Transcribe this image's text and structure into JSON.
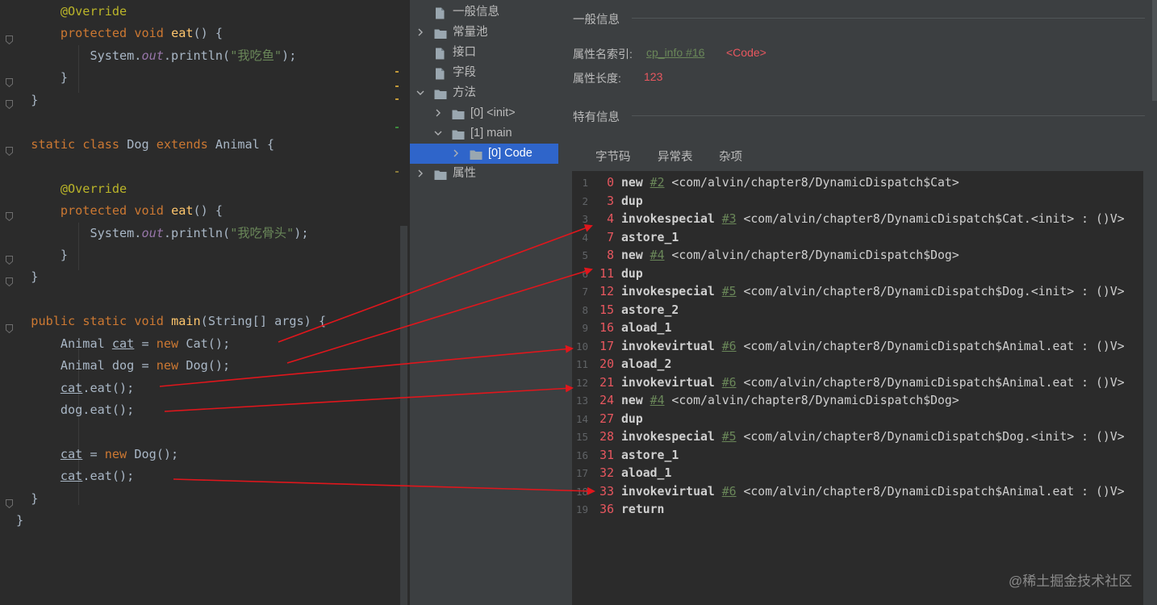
{
  "editor": {
    "lines": [
      {
        "id": "l1",
        "indent": "      ",
        "tokens": [
          {
            "t": "@Override",
            "c": "ann"
          }
        ]
      },
      {
        "id": "l2",
        "indent": "      ",
        "tokens": [
          {
            "t": "protected",
            "c": "kw"
          },
          {
            "t": " "
          },
          {
            "t": "void",
            "c": "kw"
          },
          {
            "t": " "
          },
          {
            "t": "eat",
            "c": "fn"
          },
          {
            "t": "() {"
          }
        ]
      },
      {
        "id": "l3",
        "indent": "          ",
        "tokens": [
          {
            "t": "System."
          },
          {
            "t": "out",
            "c": "fld"
          },
          {
            "t": ".println("
          },
          {
            "t": "\"我吃鱼\"",
            "c": "str"
          },
          {
            "t": ");"
          }
        ]
      },
      {
        "id": "l4",
        "indent": "      ",
        "tokens": [
          {
            "t": "}"
          }
        ]
      },
      {
        "id": "l5",
        "indent": "  ",
        "tokens": [
          {
            "t": "}"
          }
        ]
      },
      {
        "id": "l6",
        "indent": "",
        "tokens": []
      },
      {
        "id": "l7",
        "indent": "  ",
        "tokens": [
          {
            "t": "static",
            "c": "kw"
          },
          {
            "t": " "
          },
          {
            "t": "class",
            "c": "kw"
          },
          {
            "t": " Dog "
          },
          {
            "t": "extends",
            "c": "kw"
          },
          {
            "t": " Animal {"
          }
        ]
      },
      {
        "id": "l8",
        "indent": "",
        "tokens": []
      },
      {
        "id": "l9",
        "indent": "      ",
        "tokens": [
          {
            "t": "@Override",
            "c": "ann"
          }
        ]
      },
      {
        "id": "l10",
        "indent": "      ",
        "tokens": [
          {
            "t": "protected",
            "c": "kw"
          },
          {
            "t": " "
          },
          {
            "t": "void",
            "c": "kw"
          },
          {
            "t": " "
          },
          {
            "t": "eat",
            "c": "fn"
          },
          {
            "t": "() {"
          }
        ]
      },
      {
        "id": "l11",
        "indent": "          ",
        "tokens": [
          {
            "t": "System."
          },
          {
            "t": "out",
            "c": "fld"
          },
          {
            "t": ".println("
          },
          {
            "t": "\"我吃骨头\"",
            "c": "str"
          },
          {
            "t": ");"
          }
        ]
      },
      {
        "id": "l12",
        "indent": "      ",
        "tokens": [
          {
            "t": "}"
          }
        ]
      },
      {
        "id": "l13",
        "indent": "  ",
        "tokens": [
          {
            "t": "}"
          }
        ]
      },
      {
        "id": "l14",
        "indent": "",
        "tokens": []
      },
      {
        "id": "l15",
        "indent": "  ",
        "tokens": [
          {
            "t": "public",
            "c": "kw"
          },
          {
            "t": " "
          },
          {
            "t": "static",
            "c": "kw"
          },
          {
            "t": " "
          },
          {
            "t": "void",
            "c": "kw"
          },
          {
            "t": " "
          },
          {
            "t": "main",
            "c": "fn"
          },
          {
            "t": "(String[] args) {"
          }
        ]
      },
      {
        "id": "l16",
        "indent": "      ",
        "tokens": [
          {
            "t": "Animal "
          },
          {
            "t": "cat",
            "c": "ul"
          },
          {
            "t": " = "
          },
          {
            "t": "new",
            "c": "kw"
          },
          {
            "t": " Cat();"
          }
        ]
      },
      {
        "id": "l17",
        "indent": "      ",
        "tokens": [
          {
            "t": "Animal dog = "
          },
          {
            "t": "new",
            "c": "kw"
          },
          {
            "t": " Dog();"
          }
        ]
      },
      {
        "id": "l18",
        "indent": "      ",
        "tokens": [
          {
            "t": "cat",
            "c": "ul"
          },
          {
            "t": ".eat();"
          }
        ]
      },
      {
        "id": "l19",
        "indent": "      ",
        "tokens": [
          {
            "t": "dog.eat();"
          }
        ]
      },
      {
        "id": "l20",
        "indent": "",
        "tokens": []
      },
      {
        "id": "l21",
        "indent": "      ",
        "tokens": [
          {
            "t": "cat",
            "c": "ul"
          },
          {
            "t": " = "
          },
          {
            "t": "new",
            "c": "kw"
          },
          {
            "t": " Dog();"
          }
        ]
      },
      {
        "id": "l22",
        "indent": "      ",
        "tokens": [
          {
            "t": "cat",
            "c": "ul"
          },
          {
            "t": ".eat();"
          }
        ]
      },
      {
        "id": "l23",
        "indent": "  ",
        "tokens": [
          {
            "t": "}"
          }
        ]
      },
      {
        "id": "l24",
        "indent": "",
        "tokens": [
          {
            "t": "}"
          }
        ]
      }
    ]
  },
  "tree": {
    "items": [
      {
        "label": "一般信息",
        "icon": "file",
        "chev": "",
        "level": 0
      },
      {
        "label": "常量池",
        "icon": "folder",
        "chev": "›",
        "level": 0
      },
      {
        "label": "接口",
        "icon": "file",
        "chev": "",
        "level": 0
      },
      {
        "label": "字段",
        "icon": "file",
        "chev": "",
        "level": 0
      },
      {
        "label": "方法",
        "icon": "folder",
        "chev": "⌄",
        "level": 0
      },
      {
        "label": "[0] <init>",
        "icon": "folder",
        "chev": "›",
        "level": 1
      },
      {
        "label": "[1] main",
        "icon": "folder",
        "chev": "⌄",
        "level": 1
      },
      {
        "label": "[0] Code",
        "icon": "folder",
        "chev": "›",
        "level": 2,
        "selected": true
      },
      {
        "label": "属性",
        "icon": "folder",
        "chev": "›",
        "level": 0
      }
    ]
  },
  "detail": {
    "general_title": "一般信息",
    "name_index_label": "属性名索引:",
    "name_index_link": "cp_info #16",
    "name_index_value": "<Code>",
    "length_label": "属性长度:",
    "length_value": "123",
    "specific_title": "特有信息",
    "tabs": [
      "字节码",
      "异常表",
      "杂项"
    ]
  },
  "bytecode": [
    {
      "n": "1",
      "off": "0",
      "op": "new",
      "ref": "#2",
      "arg": "<com/alvin/chapter8/DynamicDispatch$Cat>"
    },
    {
      "n": "2",
      "off": "3",
      "op": "dup",
      "ref": "",
      "arg": ""
    },
    {
      "n": "3",
      "off": "4",
      "op": "invokespecial",
      "ref": "#3",
      "arg": "<com/alvin/chapter8/DynamicDispatch$Cat.<init> : ()V>"
    },
    {
      "n": "4",
      "off": "7",
      "op": "astore_1",
      "ref": "",
      "arg": ""
    },
    {
      "n": "5",
      "off": "8",
      "op": "new",
      "ref": "#4",
      "arg": "<com/alvin/chapter8/DynamicDispatch$Dog>"
    },
    {
      "n": "6",
      "off": "11",
      "op": "dup",
      "ref": "",
      "arg": ""
    },
    {
      "n": "7",
      "off": "12",
      "op": "invokespecial",
      "ref": "#5",
      "arg": "<com/alvin/chapter8/DynamicDispatch$Dog.<init> : ()V>"
    },
    {
      "n": "8",
      "off": "15",
      "op": "astore_2",
      "ref": "",
      "arg": ""
    },
    {
      "n": "9",
      "off": "16",
      "op": "aload_1",
      "ref": "",
      "arg": ""
    },
    {
      "n": "10",
      "off": "17",
      "op": "invokevirtual",
      "ref": "#6",
      "arg": "<com/alvin/chapter8/DynamicDispatch$Animal.eat : ()V>"
    },
    {
      "n": "11",
      "off": "20",
      "op": "aload_2",
      "ref": "",
      "arg": ""
    },
    {
      "n": "12",
      "off": "21",
      "op": "invokevirtual",
      "ref": "#6",
      "arg": "<com/alvin/chapter8/DynamicDispatch$Animal.eat : ()V>"
    },
    {
      "n": "13",
      "off": "24",
      "op": "new",
      "ref": "#4",
      "arg": "<com/alvin/chapter8/DynamicDispatch$Dog>"
    },
    {
      "n": "14",
      "off": "27",
      "op": "dup",
      "ref": "",
      "arg": ""
    },
    {
      "n": "15",
      "off": "28",
      "op": "invokespecial",
      "ref": "#5",
      "arg": "<com/alvin/chapter8/DynamicDispatch$Dog.<init> : ()V>"
    },
    {
      "n": "16",
      "off": "31",
      "op": "astore_1",
      "ref": "",
      "arg": ""
    },
    {
      "n": "17",
      "off": "32",
      "op": "aload_1",
      "ref": "",
      "arg": ""
    },
    {
      "n": "18",
      "off": "33",
      "op": "invokevirtual",
      "ref": "#6",
      "arg": "<com/alvin/chapter8/DynamicDispatch$Animal.eat : ()V>"
    },
    {
      "n": "19",
      "off": "36",
      "op": "return",
      "ref": "",
      "arg": ""
    }
  ],
  "watermark": "@稀土掘金技术社区",
  "colors": {
    "arrow": "#e0161c",
    "offset": "#e8575f",
    "selection": "#2f65ca"
  }
}
